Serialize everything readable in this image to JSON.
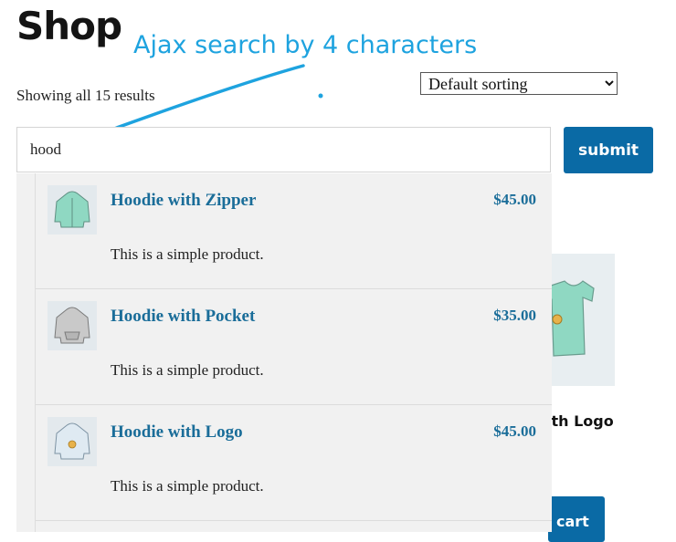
{
  "page": {
    "title": "Shop",
    "results_count": "Showing all 15 results"
  },
  "annotation": {
    "text": "Ajax search by 4 characters",
    "color": "#1ea3df"
  },
  "sorting": {
    "selected": "Default sorting"
  },
  "search": {
    "value": "hood",
    "submit_label": "submit"
  },
  "results": [
    {
      "title": "Hoodie with Zipper",
      "price": "$45.00",
      "description": "This is a simple product.",
      "icon": "hoodie-zipper-icon"
    },
    {
      "title": "Hoodie with Pocket",
      "price": "$35.00",
      "description": "This is a simple product.",
      "icon": "hoodie-pocket-icon"
    },
    {
      "title": "Hoodie with Logo",
      "price": "$45.00",
      "description": "This is a simple product.",
      "icon": "hoodie-logo-icon"
    }
  ],
  "background_product": {
    "title_fragment": "ith Logo",
    "cart_fragment": "cart",
    "icon": "tshirt-icon"
  },
  "colors": {
    "accent": "#0a6aa5",
    "link": "#1a6d99"
  }
}
